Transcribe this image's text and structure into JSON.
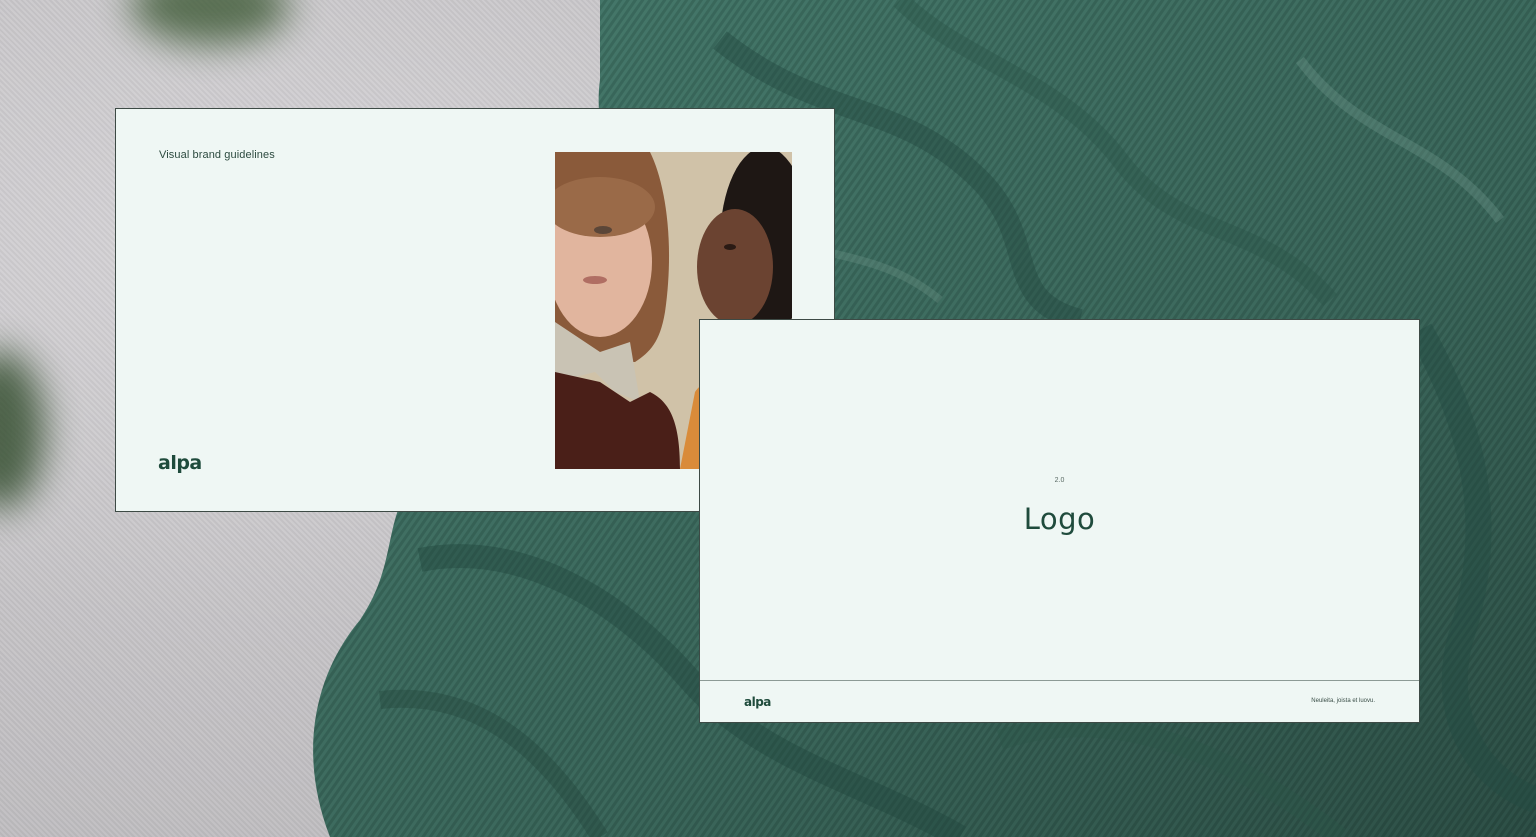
{
  "cover_slide": {
    "title": "Visual brand guidelines",
    "logo_text": "alpa"
  },
  "section_slide": {
    "section_number": "2.0",
    "section_title": "Logo",
    "logo_text": "alpa",
    "tagline": "Neuleita, joista et luovu."
  },
  "colors": {
    "slide_background": "#eff7f4",
    "brand_green": "#1f4b3c",
    "scarf_green": "#3c6b5f"
  }
}
